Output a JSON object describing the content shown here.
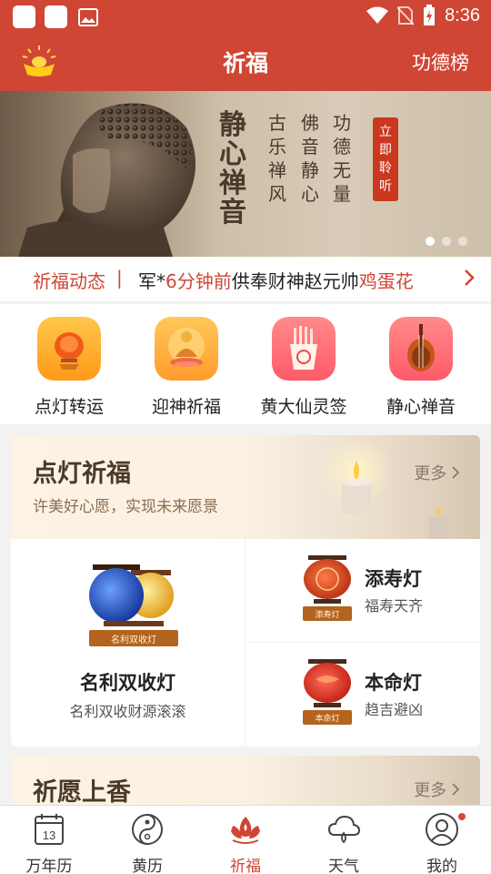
{
  "status_bar": {
    "time": "8:36"
  },
  "app_bar": {
    "title": "祈福",
    "right_link": "功德榜"
  },
  "banner": {
    "big_text": [
      "静",
      "心",
      "禅",
      "音"
    ],
    "columns": [
      [
        "古",
        "乐",
        "禅",
        "风"
      ],
      [
        "佛",
        "音",
        "静",
        "心"
      ],
      [
        "功",
        "德",
        "无",
        "量"
      ]
    ],
    "badge": [
      "立",
      "即",
      "聆",
      "听"
    ],
    "slide_count": 3,
    "active_slide": 1
  },
  "ticker": {
    "label": "祈福动态",
    "separator": "|",
    "user": "军*",
    "time_ago": "6分钟前",
    "action": "供奉财神赵元帅",
    "item": "鸡蛋花"
  },
  "quick_actions": [
    {
      "label": "点灯转运",
      "icon": "lantern-icon"
    },
    {
      "label": "迎神祈福",
      "icon": "buddha-icon"
    },
    {
      "label": "黄大仙灵签",
      "icon": "fortune-sticks-icon"
    },
    {
      "label": "静心禅音",
      "icon": "pipa-icon"
    }
  ],
  "lamp_section": {
    "title": "点灯祈福",
    "subtitle": "许美好心愿，实现未来愿景",
    "more": "更多",
    "featured": {
      "title": "名利双收灯",
      "subtitle": "名利双收财源滚滚",
      "plaque": "名利双收灯"
    },
    "items": [
      {
        "title": "添寿灯",
        "subtitle": "福寿天齐",
        "plaque": "添寿灯",
        "color": "#d64a2a"
      },
      {
        "title": "本命灯",
        "subtitle": "趋吉避凶",
        "plaque": "本命灯",
        "color": "#e03a2a"
      }
    ]
  },
  "incense_section": {
    "title": "祈愿上香",
    "more": "更多"
  },
  "bottom_nav": [
    {
      "label": "万年历",
      "icon": "calendar-icon",
      "badge_text": "13"
    },
    {
      "label": "黄历",
      "icon": "yin-yang-icon"
    },
    {
      "label": "祈福",
      "icon": "lotus-icon",
      "active": true
    },
    {
      "label": "天气",
      "icon": "weather-icon"
    },
    {
      "label": "我的",
      "icon": "profile-icon",
      "dot": true
    }
  ],
  "colors": {
    "primary": "#cf4634",
    "text_brown": "#4a3a2a"
  }
}
